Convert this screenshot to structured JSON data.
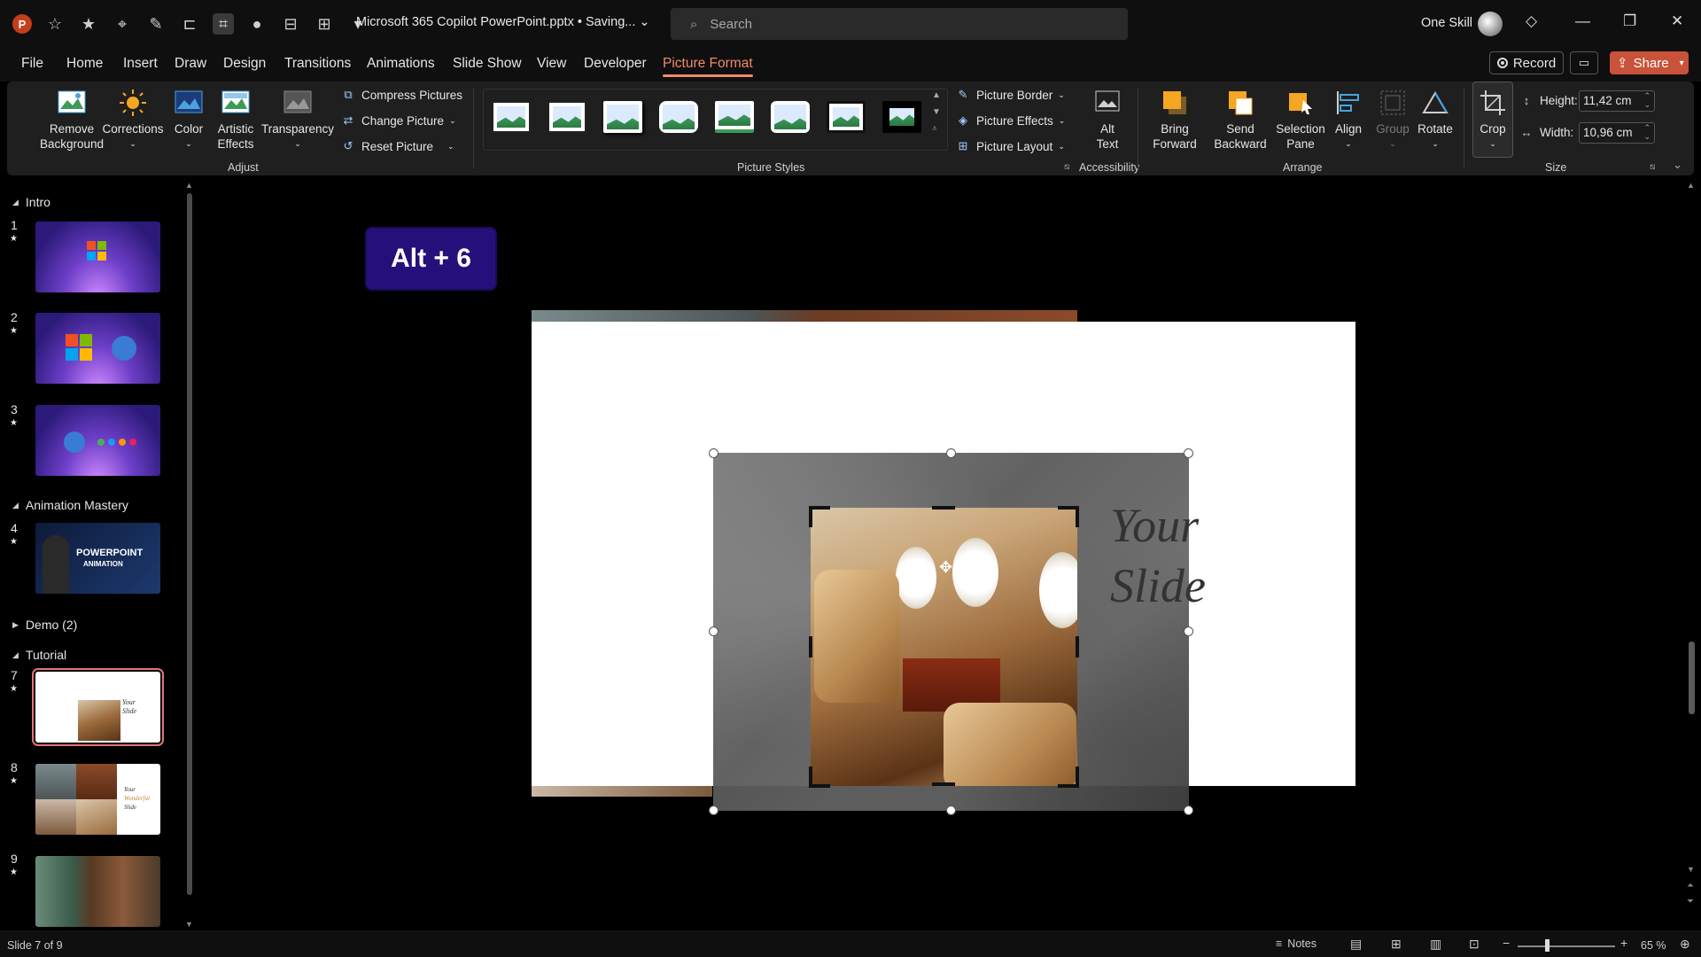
{
  "titlebar": {
    "doc_title": "Microsoft 365 Copilot PowerPoint.pptx • Saving... ⌄",
    "search_placeholder": "Search",
    "user_name": "One Skill",
    "app_logo": "P"
  },
  "tabs": [
    "File",
    "Home",
    "Insert",
    "Draw",
    "Design",
    "Transitions",
    "Animations",
    "Slide Show",
    "View",
    "Developer",
    "Picture Format"
  ],
  "active_tab": "Picture Format",
  "actions": {
    "record": "Record",
    "share": "Share"
  },
  "ribbon": {
    "adjust": {
      "remove_background": [
        "Remove",
        "Background"
      ],
      "corrections": "Corrections",
      "color": "Color",
      "artistic_effects": [
        "Artistic",
        "Effects"
      ],
      "transparency": "Transparency",
      "compress": "Compress Pictures",
      "change": "Change Picture",
      "reset": "Reset Picture",
      "label": "Adjust"
    },
    "picture_styles": {
      "border": "Picture Border",
      "effects": "Picture Effects",
      "layout": "Picture Layout",
      "label": "Picture Styles"
    },
    "accessibility": {
      "alt_text": [
        "Alt",
        "Text"
      ],
      "label": "Accessibility"
    },
    "arrange": {
      "bring_forward": [
        "Bring",
        "Forward"
      ],
      "send_backward": [
        "Send",
        "Backward"
      ],
      "selection_pane": [
        "Selection",
        "Pane"
      ],
      "align": "Align",
      "group": "Group",
      "rotate": "Rotate",
      "label": "Arrange"
    },
    "size": {
      "crop": "Crop",
      "height_label": "Height:",
      "height_value": "11,42 cm",
      "width_label": "Width:",
      "width_value": "10,96 cm",
      "label": "Size"
    }
  },
  "slide_panel": {
    "sections": [
      "Intro",
      "Animation Mastery",
      "Demo (2)",
      "Tutorial"
    ],
    "slides": [
      {
        "num": "1",
        "theme": "purple"
      },
      {
        "num": "2",
        "theme": "purple"
      },
      {
        "num": "3",
        "theme": "purple"
      },
      {
        "num": "4",
        "text": [
          "POWERPOINT",
          "ANIMATION"
        ]
      },
      {
        "num": "7",
        "text": [
          "Your",
          "Slide"
        ],
        "selected": true
      },
      {
        "num": "8",
        "text": [
          "Your",
          "Wonderful",
          "Slide"
        ]
      },
      {
        "num": "9"
      }
    ]
  },
  "canvas": {
    "shortcut_badge": "Alt + 6",
    "slide_text_line1": "Your",
    "slide_text_line2": "Slide"
  },
  "status": {
    "slide_info": "Slide 7 of 9",
    "notes": "Notes",
    "zoom": "65 %"
  },
  "colors": {
    "accent": "#f08a6a",
    "share": "#c8533a",
    "badge": "#24107a"
  }
}
